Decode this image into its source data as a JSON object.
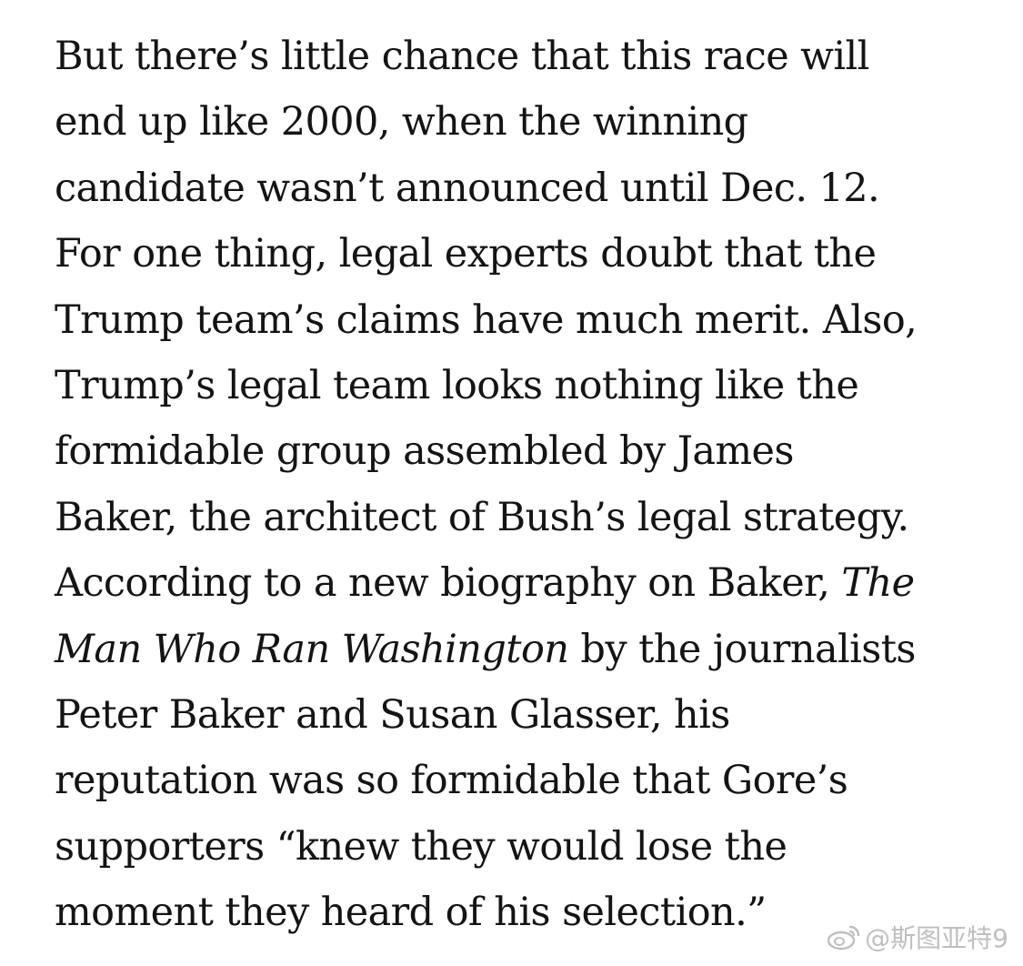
{
  "article": {
    "lines": [
      "But there’s little chance that this race will",
      "end up like 2000, when the winning",
      "candidate wasn’t announced until Dec. 12.",
      "For one thing, legal experts doubt that the",
      "Trump team’s claims have much merit. Also,",
      "Trump’s legal team looks nothing like the",
      "formidable group assembled by James",
      "Baker, the architect of Bush’s legal strategy.",
      "According to a new biography on Baker,",
      "The",
      "Man Who Ran Washington",
      "by the journalists",
      "Peter Baker and Susan Glasser, his",
      "reputation was so formidable that Gore’s",
      "supporters “knew they would lose the",
      "moment they heard of his selection.”"
    ]
  },
  "watermark": {
    "icon": "weibo-icon",
    "text": "@斯图亚特9"
  }
}
